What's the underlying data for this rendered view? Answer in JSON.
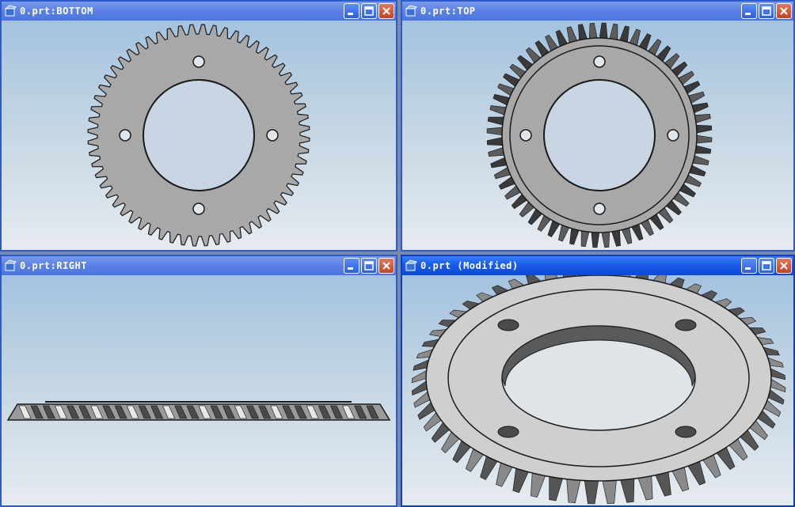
{
  "windows": [
    {
      "id": "bottom",
      "title": "0.prt:BOTTOM"
    },
    {
      "id": "top",
      "title": "0.prt:TOP"
    },
    {
      "id": "right",
      "title": "0.prt:RIGHT"
    },
    {
      "id": "iso",
      "title": "0.prt (Modified)"
    }
  ],
  "colors": {
    "title_active": "#0b48d8",
    "title_inactive": "#5b82e6",
    "gear_face": "#a8a8a8",
    "gear_outline": "#1a1a1a",
    "viewport_top": "#a3c3df",
    "viewport_bottom": "#e6ebf0"
  },
  "icons": {
    "app": "part-file-icon",
    "minimize": "minimize-icon",
    "maximize": "maximize-icon",
    "close": "close-icon"
  }
}
